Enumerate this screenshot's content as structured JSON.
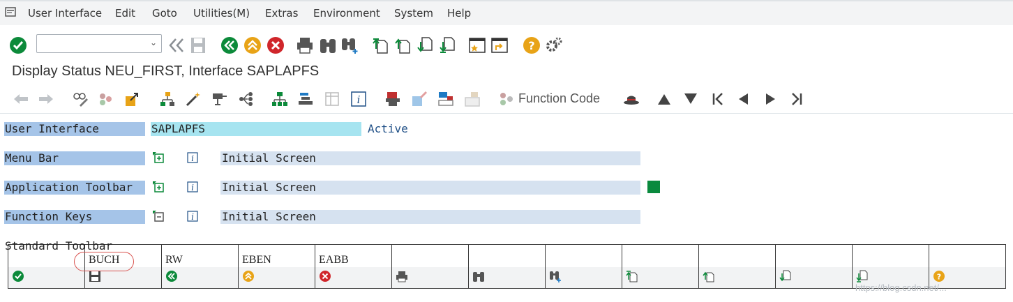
{
  "menubar": {
    "items": [
      "User Interface",
      "Edit",
      "Goto",
      "Utilities(M)",
      "Extras",
      "Environment",
      "System",
      "Help"
    ]
  },
  "system_toolbar": {
    "command_field_value": "",
    "icons": [
      "enter-icon",
      "back-double-icon",
      "save-icon",
      "back-icon",
      "exit-icon",
      "cancel-icon",
      "print-icon",
      "find-icon",
      "find-next-icon",
      "first-page-icon",
      "previous-page-icon",
      "next-page-icon",
      "last-page-icon",
      "create-session-icon",
      "shortcut-icon",
      "help-icon",
      "customize-icon"
    ]
  },
  "title": "Display Status NEU_FIRST, Interface SAPLAPFS",
  "app_toolbar": {
    "function_code_label": "Function Code"
  },
  "form": {
    "user_interface": {
      "label": "User Interface",
      "value": "SAPLAPFS",
      "status": "Active"
    },
    "menu_bar": {
      "label": "Menu Bar",
      "value": "Initial Screen"
    },
    "application_toolbar": {
      "label": "Application Toolbar",
      "value": "Initial Screen"
    },
    "function_keys": {
      "label": "Function Keys",
      "value": "Initial Screen"
    }
  },
  "standard_toolbar": {
    "label": "Standard Toolbar",
    "cells": [
      {
        "code": "",
        "icon": "enter-icon"
      },
      {
        "code": "BUCH",
        "icon": "save-icon"
      },
      {
        "code": "RW",
        "icon": "back-icon"
      },
      {
        "code": "EBEN",
        "icon": "exit-icon"
      },
      {
        "code": "EABB",
        "icon": "cancel-icon"
      },
      {
        "code": "",
        "icon": "print-icon"
      },
      {
        "code": "",
        "icon": "find-icon"
      },
      {
        "code": "",
        "icon": "find-next-icon"
      },
      {
        "code": "",
        "icon": "first-page-icon"
      },
      {
        "code": "",
        "icon": "previous-page-icon"
      },
      {
        "code": "",
        "icon": "next-page-icon"
      },
      {
        "code": "",
        "icon": "last-page-icon"
      },
      {
        "code": "",
        "icon": "help-icon"
      }
    ]
  },
  "watermark": "https://blog.csdn.net/..."
}
